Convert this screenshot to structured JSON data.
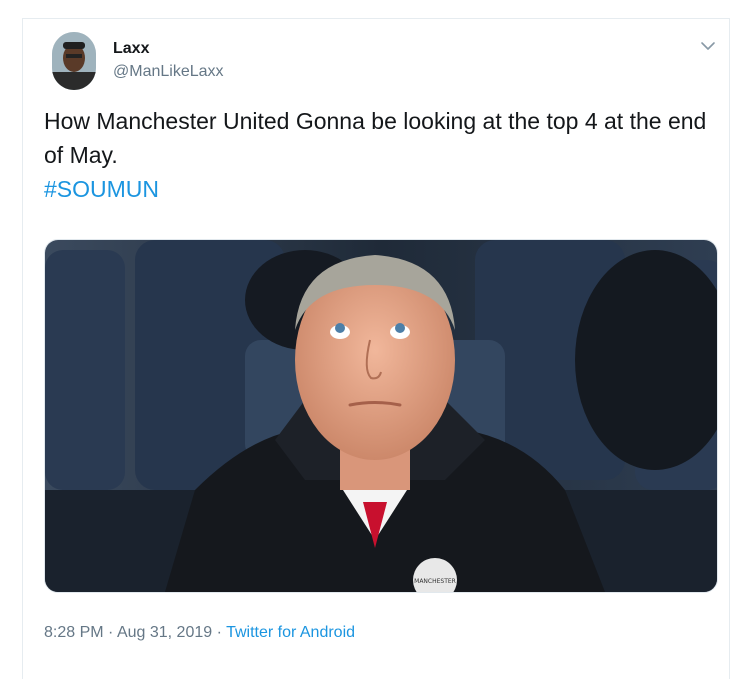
{
  "tweet": {
    "author": {
      "display_name": "Laxx",
      "handle": "@ManLikeLaxx"
    },
    "text": "How Manchester United Gonna be looking at the top 4 at the end of May.",
    "hashtag": "#SOUMUN",
    "media": {
      "badge_text": "MANCHESTER"
    },
    "time": "8:28 PM",
    "separator": "·",
    "date": "Aug 31, 2019",
    "source": "Twitter for Android"
  },
  "colors": {
    "link": "#1b95e0",
    "text": "#14171a",
    "muted": "#657786"
  },
  "icons": {
    "menu": "chevron-down-icon"
  }
}
